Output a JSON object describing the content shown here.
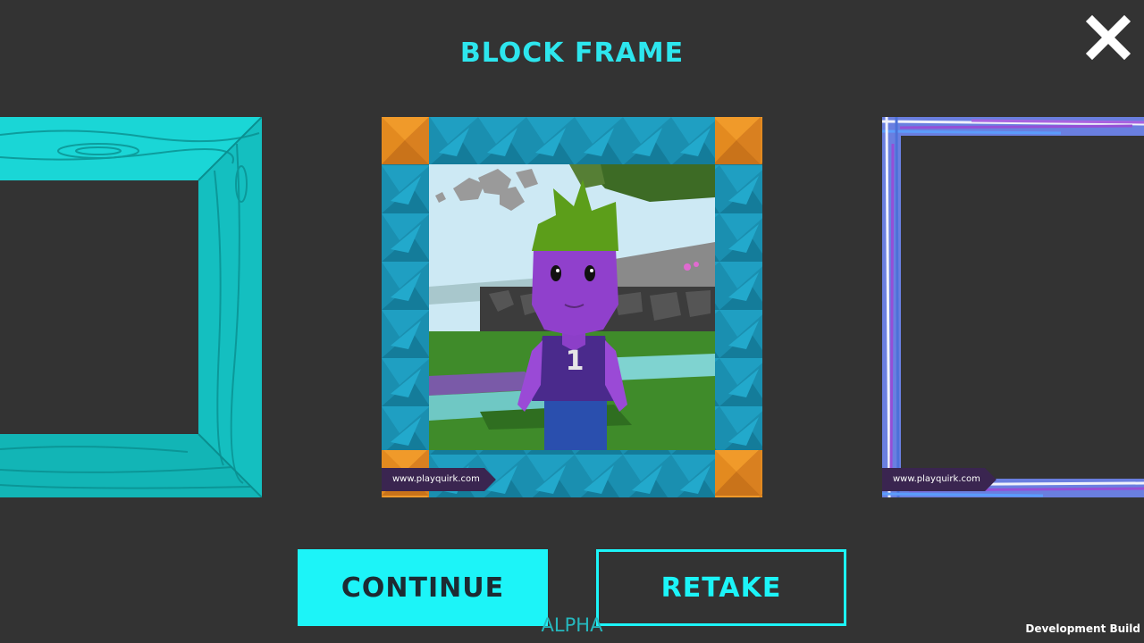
{
  "title": "BLOCK FRAME",
  "close_icon": "close-icon",
  "frames": {
    "left": {
      "style": "wood frame",
      "color": "#17d0d0"
    },
    "center": {
      "style": "block frame",
      "url": "www.playquirk.com",
      "corner_color": "#e08a1e",
      "border_color": "#1689a8"
    },
    "right": {
      "style": "crayon frame",
      "url": "www.playquirk.com"
    }
  },
  "buttons": {
    "continue": "CONTINUE",
    "retake": "RETAKE"
  },
  "alpha_label": "ALPHA",
  "dev_build_label": "Development Build",
  "colors": {
    "accent": "#1cf4f8",
    "title": "#2de6ee",
    "background": "#333333"
  }
}
